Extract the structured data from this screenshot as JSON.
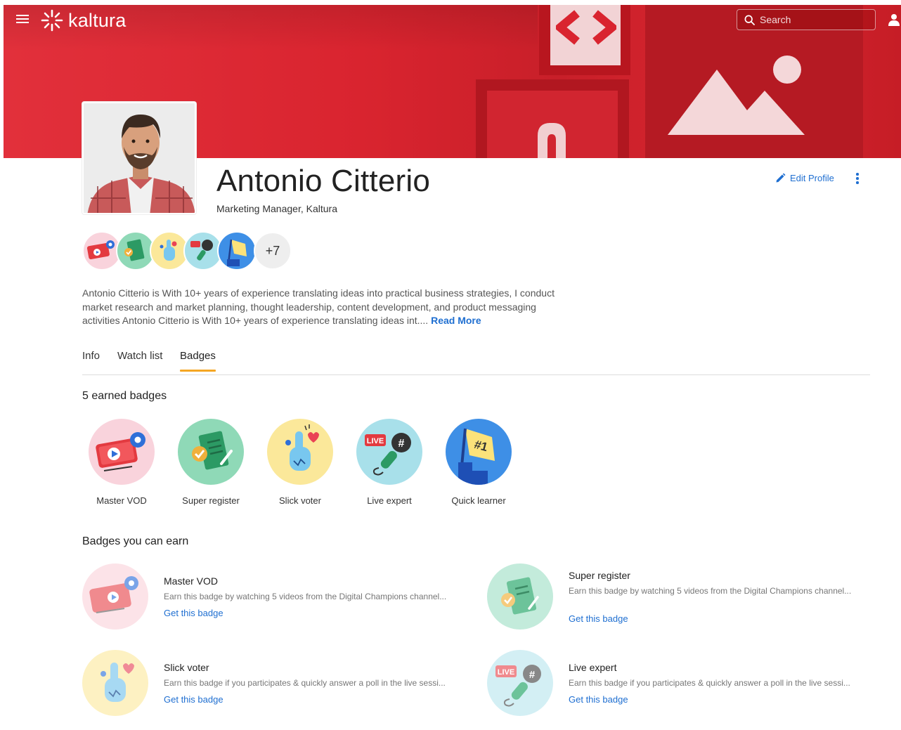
{
  "app": {
    "logo_text": "kaltura"
  },
  "header": {
    "search_placeholder": "Search"
  },
  "colors": {
    "brand_red": "#d9242f",
    "link_blue": "#1f6fd1",
    "tab_accent": "#f5a623"
  },
  "profile": {
    "name": "Antonio Citterio",
    "role": "Marketing Manager, Kaltura",
    "edit_label": "Edit Profile",
    "more_badges": "+7",
    "bio": "Antonio Citterio is With 10+ years of experience translating ideas into practical business strategies, I conduct market research and market planning, thought leadership, content development, and product messaging activities Antonio Citterio is With 10+ years of experience translating ideas int....",
    "read_more": "Read More"
  },
  "tabs": [
    {
      "label": "Info"
    },
    {
      "label": "Watch list"
    },
    {
      "label": "Badges"
    }
  ],
  "active_tab": "Badges",
  "earned": {
    "title": "5 earned badges",
    "items": [
      {
        "label": "Master VOD",
        "icon": "video-badge-icon"
      },
      {
        "label": "Super register",
        "icon": "register-badge-icon"
      },
      {
        "label": "Slick voter",
        "icon": "voter-badge-icon"
      },
      {
        "label": "Live expert",
        "icon": "live-badge-icon"
      },
      {
        "label": "Quick learner",
        "icon": "learner-badge-icon"
      }
    ]
  },
  "earnable": {
    "title": "Badges you can earn",
    "items": [
      {
        "title": "Master VOD",
        "desc": "Earn this badge by watching 5 videos from the Digital Champions channel...",
        "cta": "Get this badge"
      },
      {
        "title": "Super register",
        "desc": "Earn this badge by watching 5 videos from the Digital Champions channel...",
        "cta": "Get this badge"
      },
      {
        "title": "Slick voter",
        "desc": "Earn this badge if you participates & quickly answer a poll in the live sessi...",
        "cta": "Get this badge"
      },
      {
        "title": "Live expert",
        "desc": "Earn this badge if you participates & quickly answer a poll in the live sessi...",
        "cta": "Get this badge"
      }
    ]
  }
}
